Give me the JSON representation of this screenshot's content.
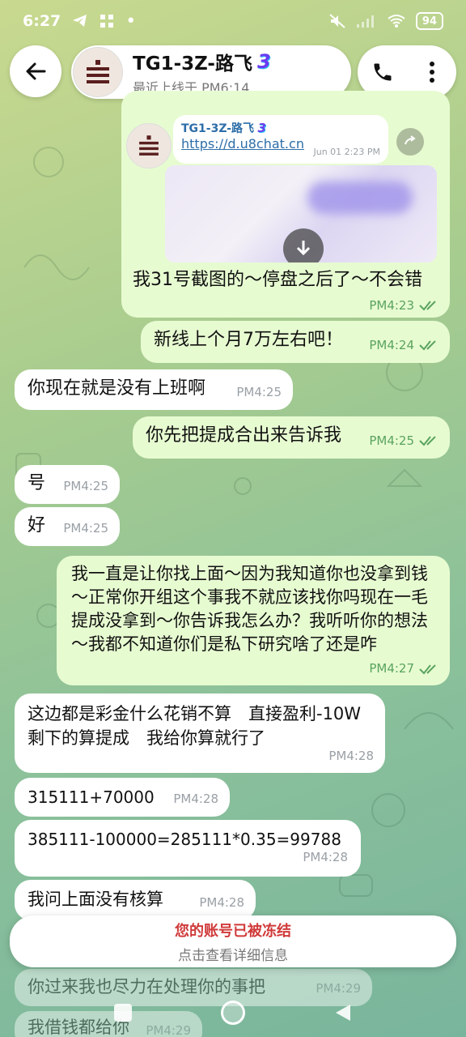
{
  "status": {
    "time": "6:27",
    "battery": "94"
  },
  "header": {
    "title": "TG1-3Z-路飞",
    "subtitle": "最近上线于 PM6:14"
  },
  "forward": {
    "name": "TG1-3Z-路飞",
    "link": "https://d.u8chat.cn",
    "time": "Jun 01 2:23 PM"
  },
  "messages": [
    {
      "dir": "out",
      "text": "我31号截图的～停盘之后了～不会错",
      "time": "PM4:23"
    },
    {
      "dir": "out",
      "text": "新线上个月7万左右吧！",
      "time": "PM4:24"
    },
    {
      "dir": "in",
      "text": "你现在就是没有上班啊",
      "time": "PM4:25"
    },
    {
      "dir": "out",
      "text": "你先把提成合出来告诉我",
      "time": "PM4:25"
    },
    {
      "dir": "in",
      "text": "号",
      "time": "PM4:25"
    },
    {
      "dir": "in",
      "text": "好",
      "time": "PM4:25"
    },
    {
      "dir": "out",
      "text": "我一直是让你找上面～因为我知道你也没拿到钱～正常你开组这个事我不就应该找你吗现在一毛提成没拿到～你告诉我怎么办？我听听你的想法～我都不知道你们是私下研究啥了还是咋",
      "time": "PM4:27"
    },
    {
      "dir": "in",
      "text": "这边都是彩金什么花销不算　直接盈利-10W　剩下的算提成　我给你算就行了",
      "time": "PM4:28"
    },
    {
      "dir": "in",
      "text": "315111+70000",
      "time": "PM4:28"
    },
    {
      "dir": "in",
      "text": "385111-100000=285111*0.35=99788",
      "time": "PM4:28"
    },
    {
      "dir": "in",
      "text": "我问上面没有核算",
      "time": "PM4:28"
    },
    {
      "dir": "in",
      "text": "你过来我也尽力在处理你的事把",
      "time": "PM4:29"
    },
    {
      "dir": "in",
      "text": "我借钱都给你",
      "time": "PM4:29"
    }
  ],
  "banner": {
    "title": "您的账号已被冻结",
    "subtitle": "点击查看详细信息"
  },
  "colors": {
    "outgoing_bubble": "#e7fbd1",
    "incoming_bubble": "#ffffff",
    "out_time": "#5aa45f",
    "frozen_red": "#d03a3a"
  },
  "icons": {
    "back": "back-arrow-icon",
    "call": "phone-icon",
    "more": "more-vertical-icon",
    "download": "download-icon",
    "share": "share-icon",
    "read": "double-check-icon"
  }
}
